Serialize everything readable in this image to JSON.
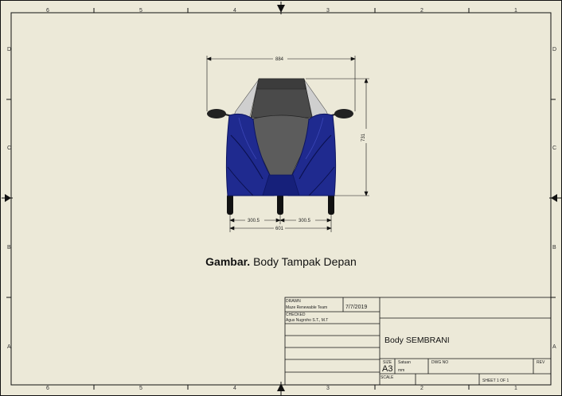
{
  "zones": {
    "top_numbers": [
      "6",
      "5",
      "4",
      "3",
      "2",
      "1"
    ],
    "left_letters": [
      "D",
      "C",
      "B",
      "A"
    ]
  },
  "dimensions": {
    "top_width": "884",
    "height": "731",
    "left_track": "300.5",
    "right_track": "300.5",
    "total_track": "601"
  },
  "caption": {
    "bold": "Gambar.",
    "text": " Body Tampak Depan"
  },
  "title_block": {
    "drawn_label": "DRAWN",
    "drawn_name": "Maze Renewable Team",
    "drawn_date": "7/7/2019",
    "checked_label": "CHECKED",
    "checked_name": "Agus Nugroho S.T., M.T",
    "title": "Body SEMBRANI",
    "size_label": "SIZE",
    "size_value": "A3",
    "unit_label": "Satuan",
    "unit_value": "mm",
    "dwg_label": "DWG NO",
    "rev_label": "REV",
    "scale_label": "SCALE",
    "sheet_label": "SHEET 1  OF 1"
  },
  "colors": {
    "body_blue": "#1f2a8f",
    "dark_blue": "#0d1560",
    "roof_gray": "#5a5a5a",
    "paper": "#ece9d8"
  }
}
